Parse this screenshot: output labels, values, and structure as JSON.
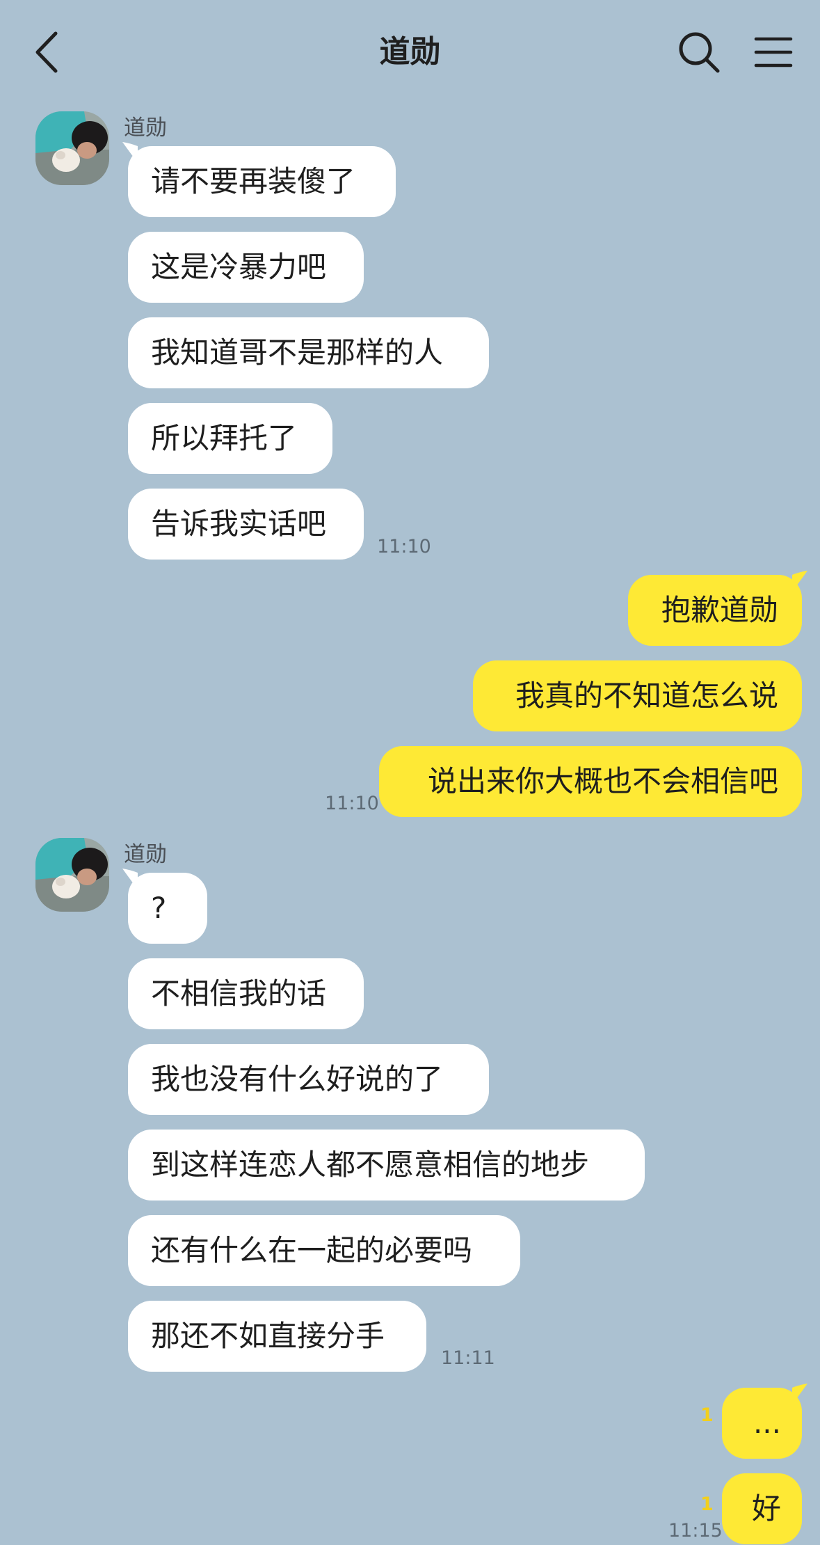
{
  "header": {
    "title": "道勋",
    "back_icon": "chevron-left-icon",
    "search_icon": "search-icon",
    "menu_icon": "hamburger-menu-icon"
  },
  "colors": {
    "background": "#abc1d1",
    "incoming_bubble": "#ffffff",
    "outgoing_bubble": "#fee935",
    "unread_count": "#f2cf1c"
  },
  "messages": {
    "group1": {
      "sender": "道勋",
      "items": [
        {
          "text": "请不要再装傻了"
        },
        {
          "text": "这是冷暴力吧"
        },
        {
          "text": "我知道哥不是那样的人"
        },
        {
          "text": "所以拜托了"
        },
        {
          "text": "告诉我实话吧"
        }
      ],
      "time": "11:10"
    },
    "group2": {
      "items": [
        {
          "text": "抱歉道勋"
        },
        {
          "text": "我真的不知道怎么说"
        },
        {
          "text": "说出来你大概也不会相信吧"
        }
      ],
      "time": "11:10"
    },
    "group3": {
      "sender": "道勋",
      "items": [
        {
          "text": "?"
        },
        {
          "text": "不相信我的话"
        },
        {
          "text": "我也没有什么好说的了"
        },
        {
          "text": "到这样连恋人都不愿意相信的地步"
        },
        {
          "text": "还有什么在一起的必要吗"
        },
        {
          "text": "那还不如直接分手"
        }
      ],
      "time": "11:11"
    },
    "group4": {
      "items": [
        {
          "text": "...",
          "unread": "1"
        },
        {
          "text": "好",
          "unread": "1"
        }
      ],
      "time": "11:15"
    }
  }
}
